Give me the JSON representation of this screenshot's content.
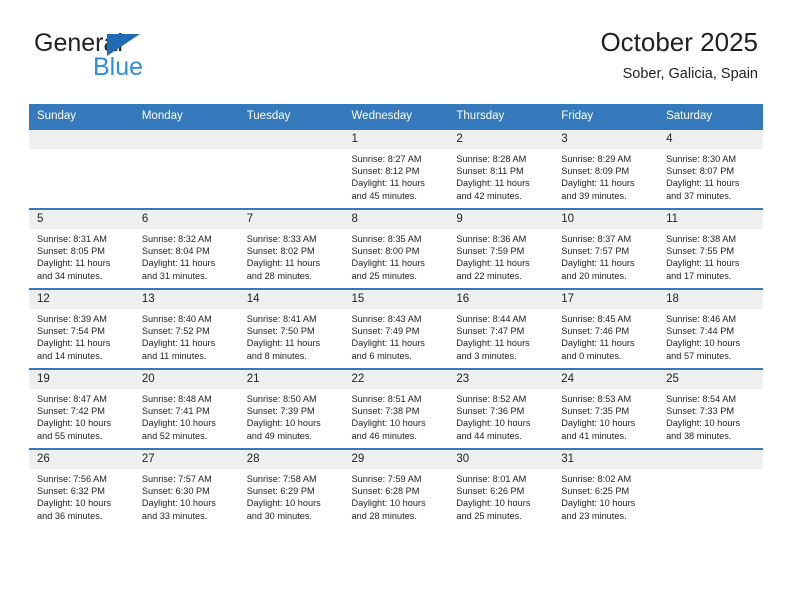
{
  "logo": {
    "word1": "General",
    "word2": "Blue",
    "triangle_color": "#1f6cb4",
    "word2_color": "#2e8ddd"
  },
  "header": {
    "title": "October 2025",
    "subtitle": "Sober, Galicia, Spain"
  },
  "theme": {
    "header_bg": "#3579bd",
    "daynum_bg": "#efeff0",
    "text": "#231f20"
  },
  "weekday_headers": [
    "Sunday",
    "Monday",
    "Tuesday",
    "Wednesday",
    "Thursday",
    "Friday",
    "Saturday"
  ],
  "weeks": [
    [
      {
        "day": "",
        "sunrise": "",
        "sunset": "",
        "daylight1": "",
        "daylight2": ""
      },
      {
        "day": "",
        "sunrise": "",
        "sunset": "",
        "daylight1": "",
        "daylight2": ""
      },
      {
        "day": "",
        "sunrise": "",
        "sunset": "",
        "daylight1": "",
        "daylight2": ""
      },
      {
        "day": "1",
        "sunrise": "Sunrise: 8:27 AM",
        "sunset": "Sunset: 8:12 PM",
        "daylight1": "Daylight: 11 hours",
        "daylight2": "and 45 minutes."
      },
      {
        "day": "2",
        "sunrise": "Sunrise: 8:28 AM",
        "sunset": "Sunset: 8:11 PM",
        "daylight1": "Daylight: 11 hours",
        "daylight2": "and 42 minutes."
      },
      {
        "day": "3",
        "sunrise": "Sunrise: 8:29 AM",
        "sunset": "Sunset: 8:09 PM",
        "daylight1": "Daylight: 11 hours",
        "daylight2": "and 39 minutes."
      },
      {
        "day": "4",
        "sunrise": "Sunrise: 8:30 AM",
        "sunset": "Sunset: 8:07 PM",
        "daylight1": "Daylight: 11 hours",
        "daylight2": "and 37 minutes."
      }
    ],
    [
      {
        "day": "5",
        "sunrise": "Sunrise: 8:31 AM",
        "sunset": "Sunset: 8:05 PM",
        "daylight1": "Daylight: 11 hours",
        "daylight2": "and 34 minutes."
      },
      {
        "day": "6",
        "sunrise": "Sunrise: 8:32 AM",
        "sunset": "Sunset: 8:04 PM",
        "daylight1": "Daylight: 11 hours",
        "daylight2": "and 31 minutes."
      },
      {
        "day": "7",
        "sunrise": "Sunrise: 8:33 AM",
        "sunset": "Sunset: 8:02 PM",
        "daylight1": "Daylight: 11 hours",
        "daylight2": "and 28 minutes."
      },
      {
        "day": "8",
        "sunrise": "Sunrise: 8:35 AM",
        "sunset": "Sunset: 8:00 PM",
        "daylight1": "Daylight: 11 hours",
        "daylight2": "and 25 minutes."
      },
      {
        "day": "9",
        "sunrise": "Sunrise: 8:36 AM",
        "sunset": "Sunset: 7:59 PM",
        "daylight1": "Daylight: 11 hours",
        "daylight2": "and 22 minutes."
      },
      {
        "day": "10",
        "sunrise": "Sunrise: 8:37 AM",
        "sunset": "Sunset: 7:57 PM",
        "daylight1": "Daylight: 11 hours",
        "daylight2": "and 20 minutes."
      },
      {
        "day": "11",
        "sunrise": "Sunrise: 8:38 AM",
        "sunset": "Sunset: 7:55 PM",
        "daylight1": "Daylight: 11 hours",
        "daylight2": "and 17 minutes."
      }
    ],
    [
      {
        "day": "12",
        "sunrise": "Sunrise: 8:39 AM",
        "sunset": "Sunset: 7:54 PM",
        "daylight1": "Daylight: 11 hours",
        "daylight2": "and 14 minutes."
      },
      {
        "day": "13",
        "sunrise": "Sunrise: 8:40 AM",
        "sunset": "Sunset: 7:52 PM",
        "daylight1": "Daylight: 11 hours",
        "daylight2": "and 11 minutes."
      },
      {
        "day": "14",
        "sunrise": "Sunrise: 8:41 AM",
        "sunset": "Sunset: 7:50 PM",
        "daylight1": "Daylight: 11 hours",
        "daylight2": "and 8 minutes."
      },
      {
        "day": "15",
        "sunrise": "Sunrise: 8:43 AM",
        "sunset": "Sunset: 7:49 PM",
        "daylight1": "Daylight: 11 hours",
        "daylight2": "and 6 minutes."
      },
      {
        "day": "16",
        "sunrise": "Sunrise: 8:44 AM",
        "sunset": "Sunset: 7:47 PM",
        "daylight1": "Daylight: 11 hours",
        "daylight2": "and 3 minutes."
      },
      {
        "day": "17",
        "sunrise": "Sunrise: 8:45 AM",
        "sunset": "Sunset: 7:46 PM",
        "daylight1": "Daylight: 11 hours",
        "daylight2": "and 0 minutes."
      },
      {
        "day": "18",
        "sunrise": "Sunrise: 8:46 AM",
        "sunset": "Sunset: 7:44 PM",
        "daylight1": "Daylight: 10 hours",
        "daylight2": "and 57 minutes."
      }
    ],
    [
      {
        "day": "19",
        "sunrise": "Sunrise: 8:47 AM",
        "sunset": "Sunset: 7:42 PM",
        "daylight1": "Daylight: 10 hours",
        "daylight2": "and 55 minutes."
      },
      {
        "day": "20",
        "sunrise": "Sunrise: 8:48 AM",
        "sunset": "Sunset: 7:41 PM",
        "daylight1": "Daylight: 10 hours",
        "daylight2": "and 52 minutes."
      },
      {
        "day": "21",
        "sunrise": "Sunrise: 8:50 AM",
        "sunset": "Sunset: 7:39 PM",
        "daylight1": "Daylight: 10 hours",
        "daylight2": "and 49 minutes."
      },
      {
        "day": "22",
        "sunrise": "Sunrise: 8:51 AM",
        "sunset": "Sunset: 7:38 PM",
        "daylight1": "Daylight: 10 hours",
        "daylight2": "and 46 minutes."
      },
      {
        "day": "23",
        "sunrise": "Sunrise: 8:52 AM",
        "sunset": "Sunset: 7:36 PM",
        "daylight1": "Daylight: 10 hours",
        "daylight2": "and 44 minutes."
      },
      {
        "day": "24",
        "sunrise": "Sunrise: 8:53 AM",
        "sunset": "Sunset: 7:35 PM",
        "daylight1": "Daylight: 10 hours",
        "daylight2": "and 41 minutes."
      },
      {
        "day": "25",
        "sunrise": "Sunrise: 8:54 AM",
        "sunset": "Sunset: 7:33 PM",
        "daylight1": "Daylight: 10 hours",
        "daylight2": "and 38 minutes."
      }
    ],
    [
      {
        "day": "26",
        "sunrise": "Sunrise: 7:56 AM",
        "sunset": "Sunset: 6:32 PM",
        "daylight1": "Daylight: 10 hours",
        "daylight2": "and 36 minutes."
      },
      {
        "day": "27",
        "sunrise": "Sunrise: 7:57 AM",
        "sunset": "Sunset: 6:30 PM",
        "daylight1": "Daylight: 10 hours",
        "daylight2": "and 33 minutes."
      },
      {
        "day": "28",
        "sunrise": "Sunrise: 7:58 AM",
        "sunset": "Sunset: 6:29 PM",
        "daylight1": "Daylight: 10 hours",
        "daylight2": "and 30 minutes."
      },
      {
        "day": "29",
        "sunrise": "Sunrise: 7:59 AM",
        "sunset": "Sunset: 6:28 PM",
        "daylight1": "Daylight: 10 hours",
        "daylight2": "and 28 minutes."
      },
      {
        "day": "30",
        "sunrise": "Sunrise: 8:01 AM",
        "sunset": "Sunset: 6:26 PM",
        "daylight1": "Daylight: 10 hours",
        "daylight2": "and 25 minutes."
      },
      {
        "day": "31",
        "sunrise": "Sunrise: 8:02 AM",
        "sunset": "Sunset: 6:25 PM",
        "daylight1": "Daylight: 10 hours",
        "daylight2": "and 23 minutes."
      },
      {
        "day": "",
        "sunrise": "",
        "sunset": "",
        "daylight1": "",
        "daylight2": ""
      }
    ]
  ]
}
